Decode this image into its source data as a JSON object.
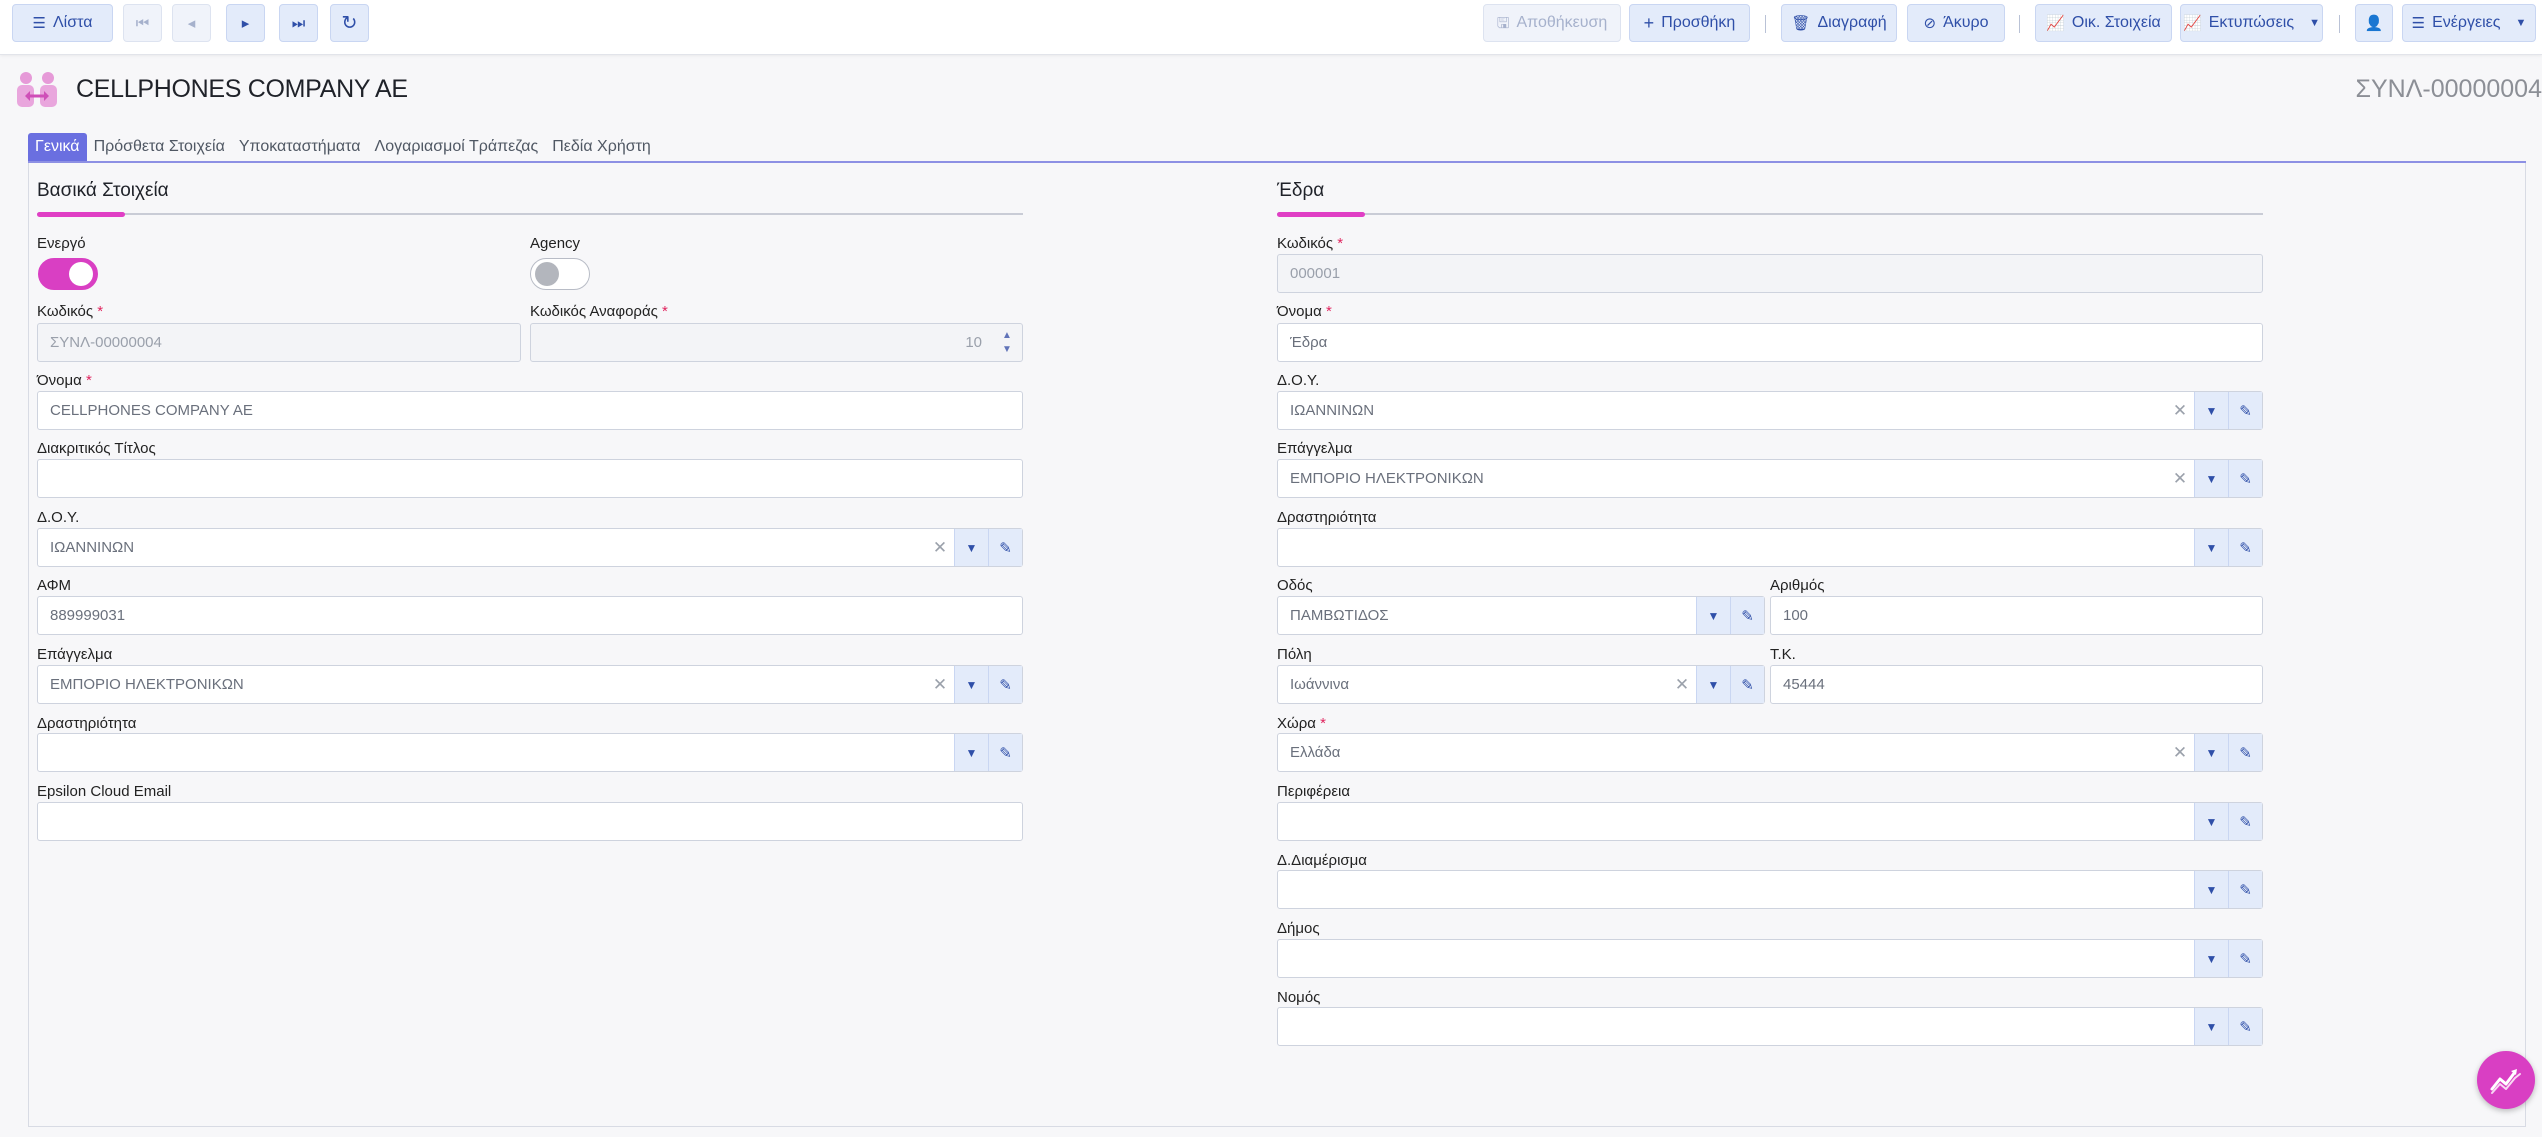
{
  "toolbar": {
    "list_label": "Λίστα",
    "save_label": "Αποθήκευση",
    "add_label": "Προσθήκη",
    "delete_label": "Διαγραφή",
    "cancel_label": "Άκυρο",
    "financial_label": "Οικ. Στοιχεία",
    "prints_label": "Εκτυπώσεις",
    "actions_label": "Ενέργειες"
  },
  "header": {
    "title": "CELLPHONES COMPANY AE",
    "record_code": "ΣΥΝΛ-00000004"
  },
  "tabs": [
    {
      "label": "Γενικά",
      "active": true
    },
    {
      "label": "Πρόσθετα Στοιχεία"
    },
    {
      "label": "Υποκαταστήματα"
    },
    {
      "label": "Λογαριασμοί Τράπεζας"
    },
    {
      "label": "Πεδία Χρήστη"
    }
  ],
  "basic": {
    "title": "Βασικά Στοιχεία",
    "active_label": "Ενεργό",
    "active": true,
    "agency_label": "Agency",
    "agency": false,
    "code_label": "Κωδικός",
    "code_value": "ΣΥΝΛ-00000004",
    "refcode_label": "Κωδικός Αναφοράς",
    "refcode_value": "10",
    "name_label": "Όνομα",
    "name_value": "CELLPHONES COMPANY AE",
    "distinctive_label": "Διακριτικός Τίτλος",
    "distinctive_value": "",
    "doy_label": "Δ.Ο.Υ.",
    "doy_value": "ΙΩΑΝΝΙΝΩΝ",
    "afm_label": "ΑΦΜ",
    "afm_value": "889999031",
    "profession_label": "Επάγγελμα",
    "profession_value": "ΕΜΠΟΡΙΟ ΗΛΕΚΤΡΟΝΙΚΩΝ",
    "activity_label": "Δραστηριότητα",
    "activity_value": "",
    "email_label": "Epsilon Cloud Email",
    "email_value": ""
  },
  "hq": {
    "title": "Έδρα",
    "code_label": "Κωδικός",
    "code_value": "000001",
    "name_label": "Όνομα",
    "name_value": "Έδρα",
    "doy_label": "Δ.Ο.Υ.",
    "doy_value": "ΙΩΑΝΝΙΝΩΝ",
    "profession_label": "Επάγγελμα",
    "profession_value": "ΕΜΠΟΡΙΟ ΗΛΕΚΤΡΟΝΙΚΩΝ",
    "activity_label": "Δραστηριότητα",
    "activity_value": "",
    "street_label": "Οδός",
    "street_value": "ΠΑΜΒΩΤΙΔΟΣ",
    "number_label": "Αριθμός",
    "number_value": "100",
    "city_label": "Πόλη",
    "city_value": "Ιωάννινα",
    "zip_label": "Τ.Κ.",
    "zip_value": "45444",
    "country_label": "Χώρα",
    "country_value": "Ελλάδα",
    "region_label": "Περιφέρεια",
    "region_value": "",
    "district_label": "Δ.Διαμέρισμα",
    "district_value": "",
    "municipality_label": "Δήμος",
    "municipality_value": "",
    "prefecture_label": "Νομός",
    "prefecture_value": ""
  },
  "colors": {
    "accent": "#d93fc3",
    "tab_active": "#6a6fe0",
    "button_bg": "#e3ebfa",
    "button_text": "#2f4fa8"
  }
}
